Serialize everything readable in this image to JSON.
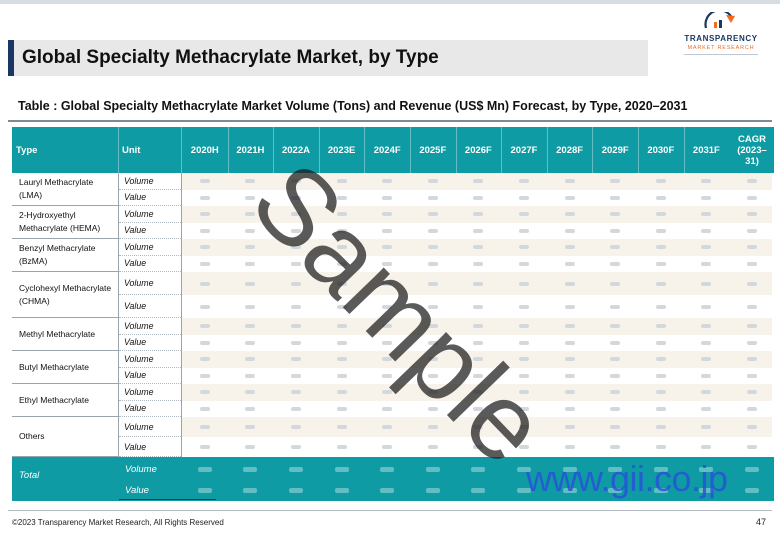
{
  "slide_title": "Global Specialty Methacrylate Market, by Type",
  "logo": {
    "name": "TRANSPARENCY",
    "subtitle": "MARKET RESEARCH"
  },
  "table_caption": "Table : Global Specialty Methacrylate Market  Volume (Tons) and Revenue (US$ Mn) Forecast, by Type, 2020–2031",
  "table": {
    "headers": {
      "type": "Type",
      "unit": "Unit",
      "years": [
        "2020H",
        "2021H",
        "2022A",
        "2023E",
        "2024F",
        "2025F",
        "2026F",
        "2027F",
        "2028F",
        "2029F",
        "2030F",
        "2031F"
      ],
      "cagr": [
        "CAGR",
        "(2023–",
        "31)"
      ]
    },
    "rows": [
      {
        "type": "Lauryl Methacrylate (LMA)",
        "units": [
          "Volume",
          "Value"
        ]
      },
      {
        "type": "2-Hydroxyethyl Methacrylate (HEMA)",
        "units": [
          "Volume",
          "Value"
        ]
      },
      {
        "type": "Benzyl Methacrylate (BzMA)",
        "units": [
          "Volume",
          "Value"
        ]
      },
      {
        "type": "Cyclohexyl Methacrylate (CHMA)",
        "units": [
          "Volume",
          "Value"
        ]
      },
      {
        "type": "Methyl Methacrylate",
        "units": [
          "Volume",
          "Value"
        ]
      },
      {
        "type": "Butyl Methacrylate",
        "units": [
          "Volume",
          "Value"
        ]
      },
      {
        "type": "Ethyl Methacrylate",
        "units": [
          "Volume",
          "Value"
        ]
      },
      {
        "type": "Others",
        "units": [
          "Volume",
          "Value"
        ]
      }
    ],
    "total": {
      "label": "Total",
      "units": [
        "Volume",
        "Value"
      ]
    }
  },
  "watermark_text": "Sample",
  "stamp_text": "www.gii.co.jp",
  "footer": {
    "copyright": "©2023 Transparency Market Research, All Rights Reserved",
    "page_number": "47"
  },
  "colors": {
    "header_teal": "#0f9ba3",
    "title_accent": "#1a3763",
    "logo_orange": "#f26b21",
    "stamp_blue": "#2850dc"
  }
}
